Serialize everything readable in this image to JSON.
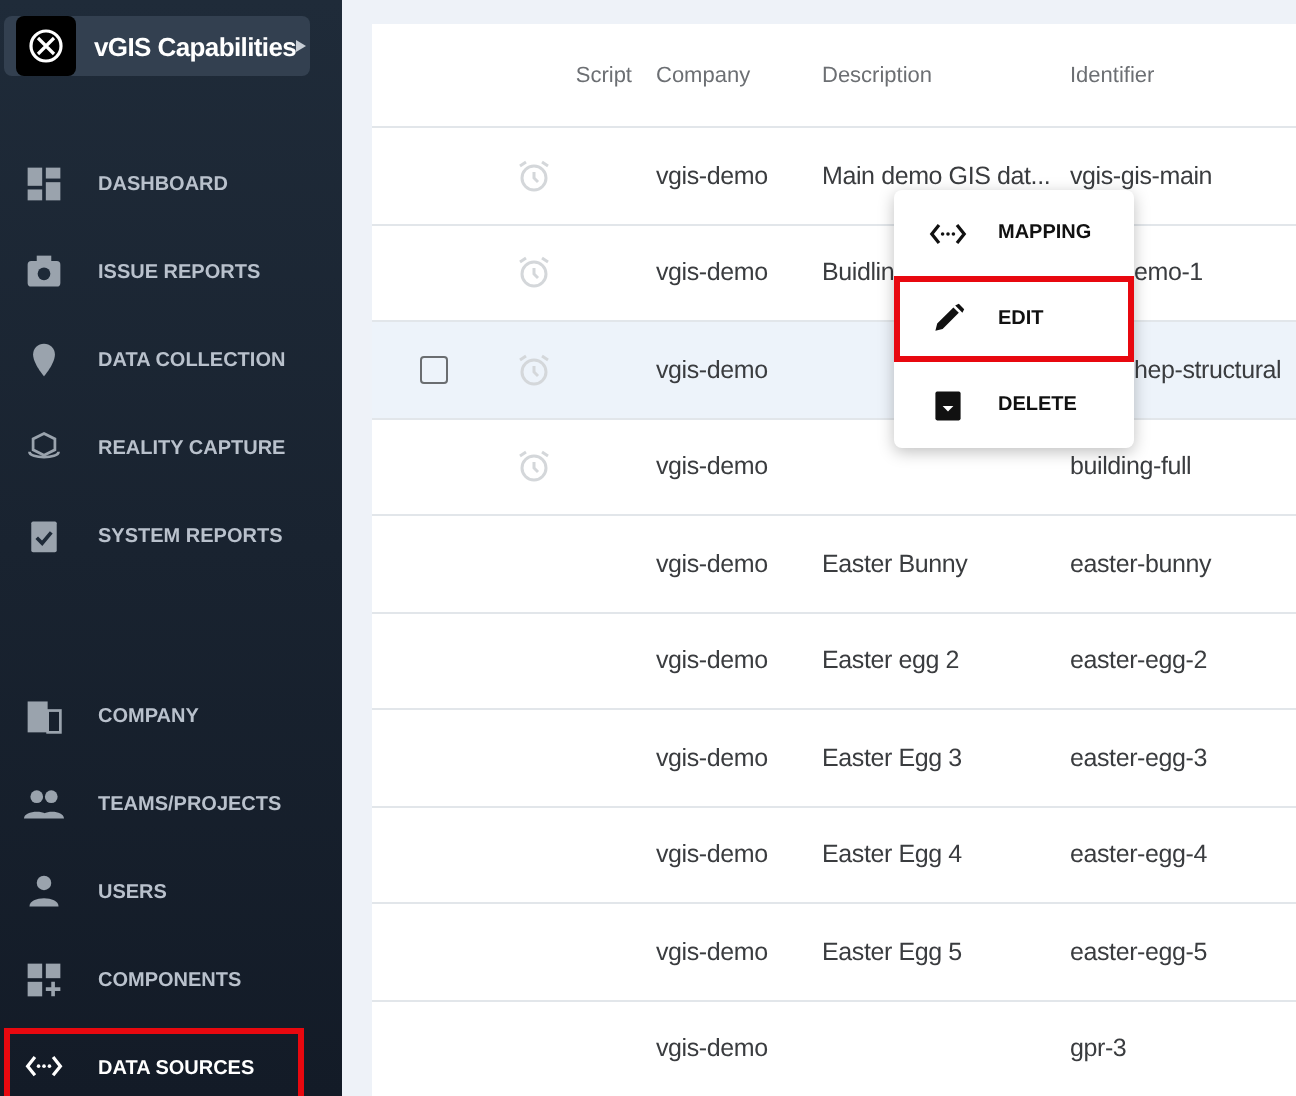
{
  "sidebar": {
    "workspace": {
      "title": "vGIS Capabilities"
    },
    "groups": [
      [
        {
          "label": "DASHBOARD",
          "selected": false,
          "highlighted": false
        },
        {
          "label": "ISSUE REPORTS",
          "selected": false,
          "highlighted": false
        },
        {
          "label": "DATA COLLECTION",
          "selected": false,
          "highlighted": false
        },
        {
          "label": "REALITY CAPTURE",
          "selected": false,
          "highlighted": false
        },
        {
          "label": "SYSTEM REPORTS",
          "selected": false,
          "highlighted": false
        }
      ],
      [
        {
          "label": "COMPANY",
          "selected": false,
          "highlighted": false
        },
        {
          "label": "TEAMS/PROJECTS",
          "selected": false,
          "highlighted": false
        },
        {
          "label": "USERS",
          "selected": false,
          "highlighted": false
        },
        {
          "label": "COMPONENTS",
          "selected": false,
          "highlighted": false
        },
        {
          "label": "DATA SOURCES",
          "selected": true,
          "highlighted": true
        }
      ]
    ]
  },
  "table": {
    "columns": [
      "Script",
      "Company",
      "Description",
      "Identifier"
    ],
    "rows": [
      {
        "script_icon": true,
        "hovered": false,
        "company": "vgis-demo",
        "description": "Main demo GIS dat...",
        "identifier": "vgis-gis-main"
      },
      {
        "script_icon": true,
        "hovered": false,
        "company": "vgis-demo",
        "description": "Buidlin",
        "identifier": "emo-1"
      },
      {
        "script_icon": true,
        "hovered": true,
        "checked": false,
        "company": "vgis-demo",
        "description": "",
        "identifier": "hep-structural"
      },
      {
        "script_icon": true,
        "hovered": false,
        "company": "vgis-demo",
        "description": "",
        "identifier": "building-full"
      },
      {
        "script_icon": false,
        "hovered": false,
        "company": "vgis-demo",
        "description": "Easter Bunny",
        "identifier": "easter-bunny"
      },
      {
        "script_icon": false,
        "hovered": false,
        "company": "vgis-demo",
        "description": "Easter egg 2",
        "identifier": "easter-egg-2"
      },
      {
        "script_icon": false,
        "hovered": false,
        "company": "vgis-demo",
        "description": "Easter Egg 3",
        "identifier": "easter-egg-3"
      },
      {
        "script_icon": false,
        "hovered": false,
        "company": "vgis-demo",
        "description": "Easter Egg 4",
        "identifier": "easter-egg-4"
      },
      {
        "script_icon": false,
        "hovered": false,
        "company": "vgis-demo",
        "description": "Easter Egg 5",
        "identifier": "easter-egg-5"
      },
      {
        "script_icon": false,
        "hovered": false,
        "company": "vgis-demo",
        "description": "",
        "identifier": "gpr-3"
      }
    ]
  },
  "context_menu": {
    "items": [
      {
        "label": "MAPPING",
        "highlighted": false
      },
      {
        "label": "EDIT",
        "highlighted": true
      },
      {
        "label": "DELETE",
        "highlighted": false
      }
    ]
  }
}
